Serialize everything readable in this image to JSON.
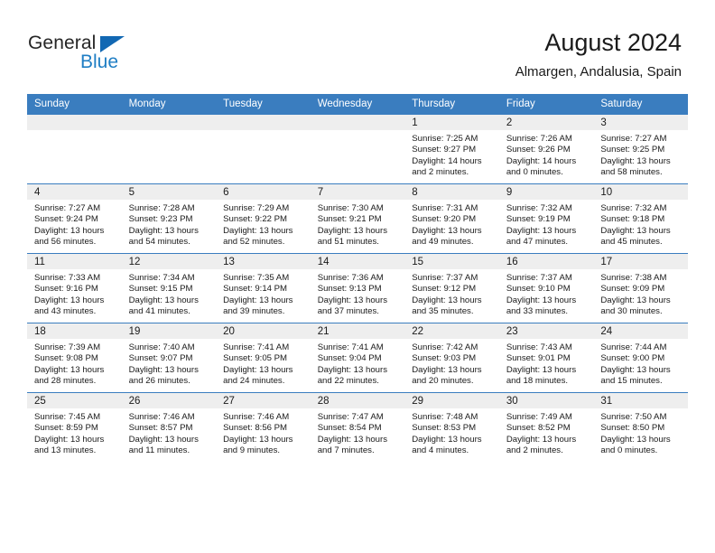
{
  "brand": {
    "name_dark": "General",
    "name_blue": "Blue",
    "triangle_icon": "blue-triangle-icon",
    "accent_color": "#1268b3",
    "blue_text_color": "#1f7ec4"
  },
  "header": {
    "title": "August 2024",
    "subtitle": "Almargen, Andalusia, Spain"
  },
  "calendar": {
    "header_bg": "#3a7dbf",
    "daynum_bg": "#eeeeee",
    "weekday_headers": [
      "Sunday",
      "Monday",
      "Tuesday",
      "Wednesday",
      "Thursday",
      "Friday",
      "Saturday"
    ],
    "weeks": [
      [
        {
          "day": "",
          "sunrise": "",
          "sunset": "",
          "daylight_line1": "",
          "daylight_line2": ""
        },
        {
          "day": "",
          "sunrise": "",
          "sunset": "",
          "daylight_line1": "",
          "daylight_line2": ""
        },
        {
          "day": "",
          "sunrise": "",
          "sunset": "",
          "daylight_line1": "",
          "daylight_line2": ""
        },
        {
          "day": "",
          "sunrise": "",
          "sunset": "",
          "daylight_line1": "",
          "daylight_line2": ""
        },
        {
          "day": "1",
          "sunrise": "Sunrise: 7:25 AM",
          "sunset": "Sunset: 9:27 PM",
          "daylight_line1": "Daylight: 14 hours",
          "daylight_line2": "and 2 minutes."
        },
        {
          "day": "2",
          "sunrise": "Sunrise: 7:26 AM",
          "sunset": "Sunset: 9:26 PM",
          "daylight_line1": "Daylight: 14 hours",
          "daylight_line2": "and 0 minutes."
        },
        {
          "day": "3",
          "sunrise": "Sunrise: 7:27 AM",
          "sunset": "Sunset: 9:25 PM",
          "daylight_line1": "Daylight: 13 hours",
          "daylight_line2": "and 58 minutes."
        }
      ],
      [
        {
          "day": "4",
          "sunrise": "Sunrise: 7:27 AM",
          "sunset": "Sunset: 9:24 PM",
          "daylight_line1": "Daylight: 13 hours",
          "daylight_line2": "and 56 minutes."
        },
        {
          "day": "5",
          "sunrise": "Sunrise: 7:28 AM",
          "sunset": "Sunset: 9:23 PM",
          "daylight_line1": "Daylight: 13 hours",
          "daylight_line2": "and 54 minutes."
        },
        {
          "day": "6",
          "sunrise": "Sunrise: 7:29 AM",
          "sunset": "Sunset: 9:22 PM",
          "daylight_line1": "Daylight: 13 hours",
          "daylight_line2": "and 52 minutes."
        },
        {
          "day": "7",
          "sunrise": "Sunrise: 7:30 AM",
          "sunset": "Sunset: 9:21 PM",
          "daylight_line1": "Daylight: 13 hours",
          "daylight_line2": "and 51 minutes."
        },
        {
          "day": "8",
          "sunrise": "Sunrise: 7:31 AM",
          "sunset": "Sunset: 9:20 PM",
          "daylight_line1": "Daylight: 13 hours",
          "daylight_line2": "and 49 minutes."
        },
        {
          "day": "9",
          "sunrise": "Sunrise: 7:32 AM",
          "sunset": "Sunset: 9:19 PM",
          "daylight_line1": "Daylight: 13 hours",
          "daylight_line2": "and 47 minutes."
        },
        {
          "day": "10",
          "sunrise": "Sunrise: 7:32 AM",
          "sunset": "Sunset: 9:18 PM",
          "daylight_line1": "Daylight: 13 hours",
          "daylight_line2": "and 45 minutes."
        }
      ],
      [
        {
          "day": "11",
          "sunrise": "Sunrise: 7:33 AM",
          "sunset": "Sunset: 9:16 PM",
          "daylight_line1": "Daylight: 13 hours",
          "daylight_line2": "and 43 minutes."
        },
        {
          "day": "12",
          "sunrise": "Sunrise: 7:34 AM",
          "sunset": "Sunset: 9:15 PM",
          "daylight_line1": "Daylight: 13 hours",
          "daylight_line2": "and 41 minutes."
        },
        {
          "day": "13",
          "sunrise": "Sunrise: 7:35 AM",
          "sunset": "Sunset: 9:14 PM",
          "daylight_line1": "Daylight: 13 hours",
          "daylight_line2": "and 39 minutes."
        },
        {
          "day": "14",
          "sunrise": "Sunrise: 7:36 AM",
          "sunset": "Sunset: 9:13 PM",
          "daylight_line1": "Daylight: 13 hours",
          "daylight_line2": "and 37 minutes."
        },
        {
          "day": "15",
          "sunrise": "Sunrise: 7:37 AM",
          "sunset": "Sunset: 9:12 PM",
          "daylight_line1": "Daylight: 13 hours",
          "daylight_line2": "and 35 minutes."
        },
        {
          "day": "16",
          "sunrise": "Sunrise: 7:37 AM",
          "sunset": "Sunset: 9:10 PM",
          "daylight_line1": "Daylight: 13 hours",
          "daylight_line2": "and 33 minutes."
        },
        {
          "day": "17",
          "sunrise": "Sunrise: 7:38 AM",
          "sunset": "Sunset: 9:09 PM",
          "daylight_line1": "Daylight: 13 hours",
          "daylight_line2": "and 30 minutes."
        }
      ],
      [
        {
          "day": "18",
          "sunrise": "Sunrise: 7:39 AM",
          "sunset": "Sunset: 9:08 PM",
          "daylight_line1": "Daylight: 13 hours",
          "daylight_line2": "and 28 minutes."
        },
        {
          "day": "19",
          "sunrise": "Sunrise: 7:40 AM",
          "sunset": "Sunset: 9:07 PM",
          "daylight_line1": "Daylight: 13 hours",
          "daylight_line2": "and 26 minutes."
        },
        {
          "day": "20",
          "sunrise": "Sunrise: 7:41 AM",
          "sunset": "Sunset: 9:05 PM",
          "daylight_line1": "Daylight: 13 hours",
          "daylight_line2": "and 24 minutes."
        },
        {
          "day": "21",
          "sunrise": "Sunrise: 7:41 AM",
          "sunset": "Sunset: 9:04 PM",
          "daylight_line1": "Daylight: 13 hours",
          "daylight_line2": "and 22 minutes."
        },
        {
          "day": "22",
          "sunrise": "Sunrise: 7:42 AM",
          "sunset": "Sunset: 9:03 PM",
          "daylight_line1": "Daylight: 13 hours",
          "daylight_line2": "and 20 minutes."
        },
        {
          "day": "23",
          "sunrise": "Sunrise: 7:43 AM",
          "sunset": "Sunset: 9:01 PM",
          "daylight_line1": "Daylight: 13 hours",
          "daylight_line2": "and 18 minutes."
        },
        {
          "day": "24",
          "sunrise": "Sunrise: 7:44 AM",
          "sunset": "Sunset: 9:00 PM",
          "daylight_line1": "Daylight: 13 hours",
          "daylight_line2": "and 15 minutes."
        }
      ],
      [
        {
          "day": "25",
          "sunrise": "Sunrise: 7:45 AM",
          "sunset": "Sunset: 8:59 PM",
          "daylight_line1": "Daylight: 13 hours",
          "daylight_line2": "and 13 minutes."
        },
        {
          "day": "26",
          "sunrise": "Sunrise: 7:46 AM",
          "sunset": "Sunset: 8:57 PM",
          "daylight_line1": "Daylight: 13 hours",
          "daylight_line2": "and 11 minutes."
        },
        {
          "day": "27",
          "sunrise": "Sunrise: 7:46 AM",
          "sunset": "Sunset: 8:56 PM",
          "daylight_line1": "Daylight: 13 hours",
          "daylight_line2": "and 9 minutes."
        },
        {
          "day": "28",
          "sunrise": "Sunrise: 7:47 AM",
          "sunset": "Sunset: 8:54 PM",
          "daylight_line1": "Daylight: 13 hours",
          "daylight_line2": "and 7 minutes."
        },
        {
          "day": "29",
          "sunrise": "Sunrise: 7:48 AM",
          "sunset": "Sunset: 8:53 PM",
          "daylight_line1": "Daylight: 13 hours",
          "daylight_line2": "and 4 minutes."
        },
        {
          "day": "30",
          "sunrise": "Sunrise: 7:49 AM",
          "sunset": "Sunset: 8:52 PM",
          "daylight_line1": "Daylight: 13 hours",
          "daylight_line2": "and 2 minutes."
        },
        {
          "day": "31",
          "sunrise": "Sunrise: 7:50 AM",
          "sunset": "Sunset: 8:50 PM",
          "daylight_line1": "Daylight: 13 hours",
          "daylight_line2": "and 0 minutes."
        }
      ]
    ]
  }
}
